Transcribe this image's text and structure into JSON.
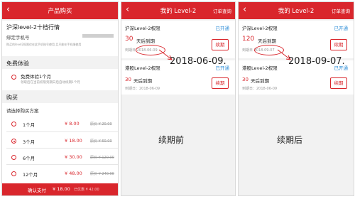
{
  "purchase": {
    "title": "产品购买",
    "product_name": "沪深level-2十档行情",
    "bind_label": "绑定手机号",
    "bind_note": "购买的level2权限仅在此手机账号使用,且只能在手机端使用",
    "free_section": "免费体验",
    "free_option": "免费体验1个月",
    "free_desc": "领取后在当前权限到期日后自动续期1个月",
    "buy_section": "购买",
    "plan_prompt": "请选择购买方案",
    "plans": [
      {
        "label": "1个月",
        "price": "¥ 8.00",
        "original": "原价 ¥ 20.00",
        "selected": false
      },
      {
        "label": "3个月",
        "price": "¥ 18.00",
        "original": "原价 ¥ 60.00",
        "selected": true
      },
      {
        "label": "6个月",
        "price": "¥ 30.00",
        "original": "原价 ¥ 120.00",
        "selected": false
      },
      {
        "label": "12个月",
        "price": "¥ 48.00",
        "original": "原价 ¥ 240.00",
        "selected": false
      }
    ],
    "pay_label": "确认支付",
    "pay_price": "¥ 18.00",
    "pay_saved": "已优惠 ¥ 42.00"
  },
  "before": {
    "title": "我的 Level-2",
    "order_link": "订单查询",
    "items": [
      {
        "name": "沪深Level-2权限",
        "status": "已开通",
        "days": "30",
        "days_suffix": "天后到期",
        "expire": "到期日 2018-06-09",
        "button": "续期"
      },
      {
        "name": "港股Level-2权限",
        "status": "已开通",
        "days": "30",
        "days_suffix": "天后到期",
        "expire": "到期日：2018-06-09",
        "button": "续期"
      }
    ],
    "annotation": "2018-06-09.",
    "caption": "续期前"
  },
  "after": {
    "title": "我的 Level-2",
    "order_link": "订单查询",
    "items": [
      {
        "name": "沪深Level-2权限",
        "status": "已开通",
        "days": "120",
        "days_suffix": "天后到期",
        "expire": "到期日 2018-09-07",
        "button": "续期"
      },
      {
        "name": "港股Level-2权限",
        "status": "已开通",
        "days": "30",
        "days_suffix": "天后到期",
        "expire": "到期日：2018-06-09",
        "button": "续期"
      }
    ],
    "annotation": "2018-09-07.",
    "caption": "续期后"
  },
  "colors": {
    "brand_red": "#d9262c",
    "link_blue": "#2a8bd6",
    "background": "#f2f2f2"
  }
}
